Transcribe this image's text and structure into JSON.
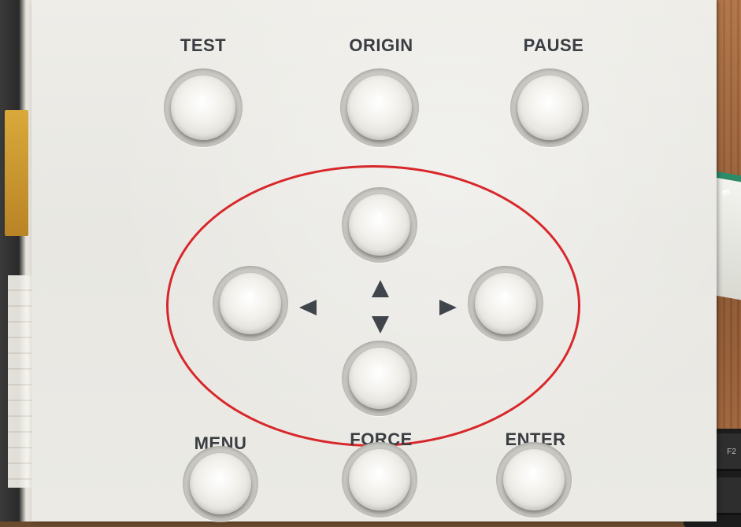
{
  "panel": {
    "labels": {
      "test": "TEST",
      "origin": "ORIGIN",
      "pause": "PAUSE",
      "menu": "MENU",
      "force": "FORCE",
      "enter": "ENTER"
    }
  },
  "background": {
    "box_label": "E",
    "keyboard_key": "F2"
  },
  "colors": {
    "panel": "#eeede8",
    "label_text": "#3a3d42",
    "highlight_circle": "#d8272a",
    "arrow": "#40454c"
  },
  "icons": {
    "left": "triangle-left-icon",
    "right": "triangle-right-icon",
    "up": "triangle-up-icon",
    "down": "triangle-down-icon"
  }
}
